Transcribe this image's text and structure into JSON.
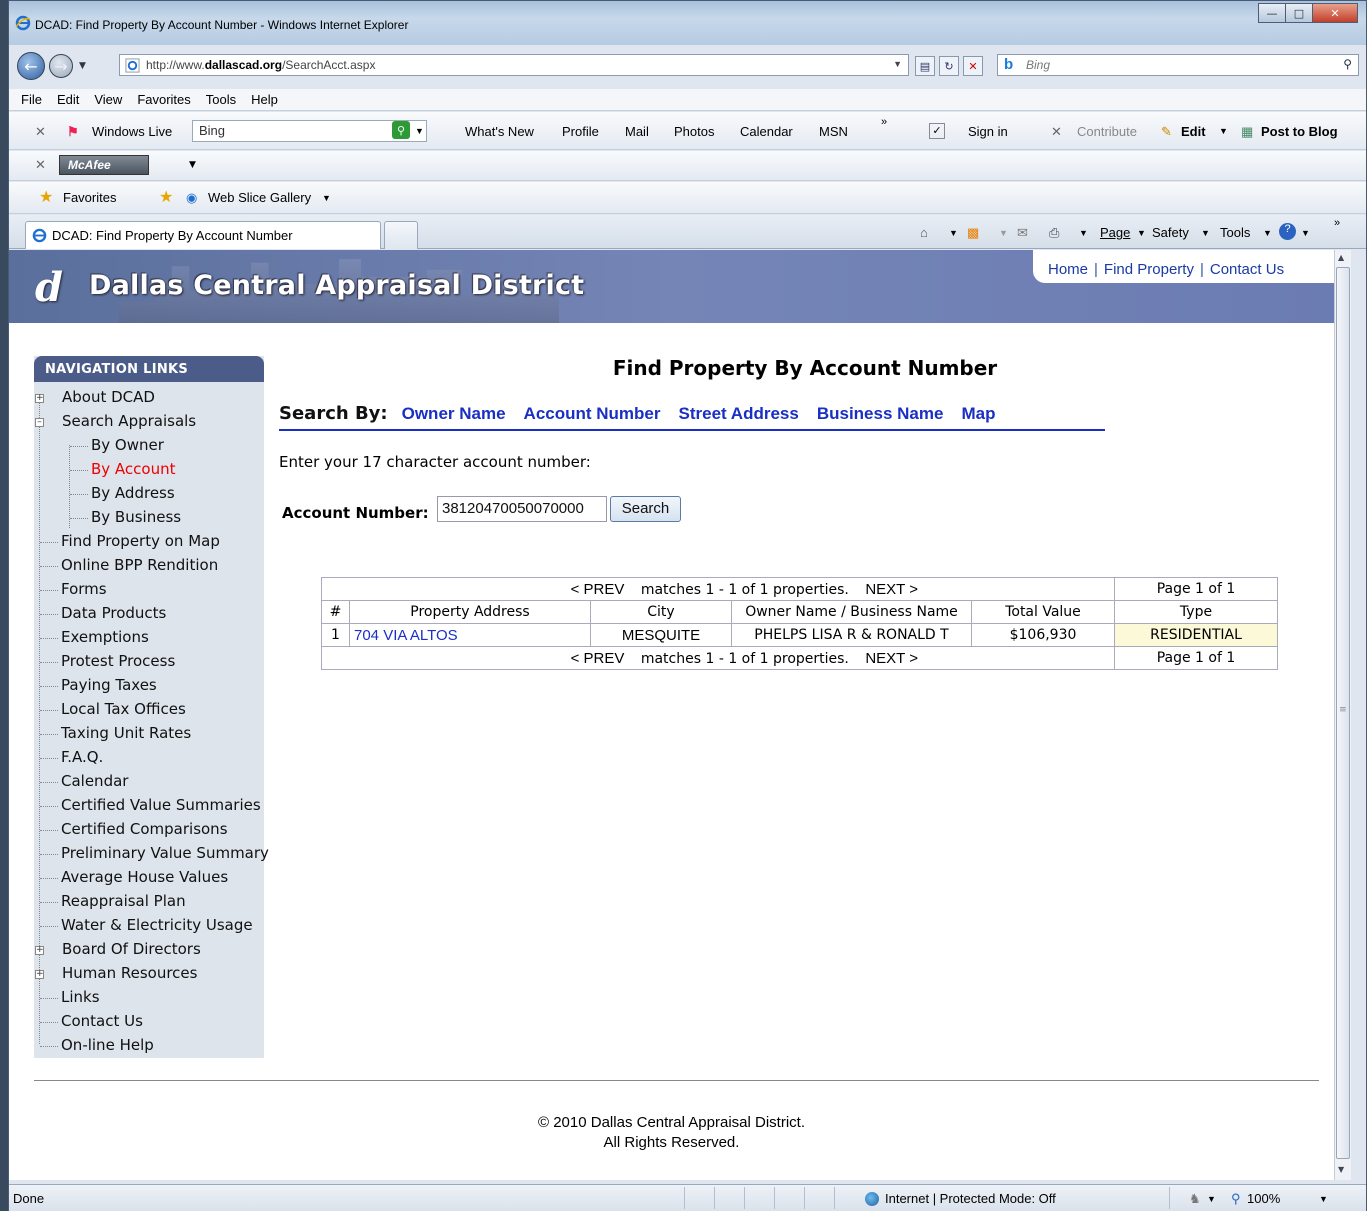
{
  "window": {
    "title": "DCAD: Find Property By Account Number - Windows Internet Explorer",
    "url_prefix": "http://www.",
    "url_domain": "dallascad.org",
    "url_path": "/SearchAcct.aspx",
    "search_engine": "Bing"
  },
  "menu": [
    "File",
    "Edit",
    "View",
    "Favorites",
    "Tools",
    "Help"
  ],
  "toolbar": {
    "windows_live": "Windows Live",
    "search_value": "Bing",
    "links": [
      "What's New",
      "Profile",
      "Mail",
      "Photos",
      "Calendar",
      "MSN"
    ],
    "sign_in": "Sign in",
    "contribute": "Contribute",
    "edit": "Edit",
    "post_to_blog": "Post to Blog",
    "mcafee": "McAfee"
  },
  "favorites_bar": {
    "favorites": "Favorites",
    "web_slice": "Web Slice Gallery"
  },
  "tab": {
    "title": "DCAD: Find Property By Account Number",
    "page_menu": "Page",
    "safety_menu": "Safety",
    "tools_menu": "Tools"
  },
  "site": {
    "name": "Dallas Central Appraisal District",
    "top_links": [
      "Home",
      "Find Property",
      "Contact Us"
    ]
  },
  "nav": {
    "header": "NAVIGATION LINKS",
    "items": [
      "About DCAD",
      "Search Appraisals",
      "By Owner",
      "By Account",
      "By Address",
      "By Business",
      "Find Property on Map",
      "Online BPP Rendition",
      "Forms",
      "Data Products",
      "Exemptions",
      "Protest Process",
      "Paying Taxes",
      "Local Tax Offices",
      "Taxing Unit Rates",
      "F.A.Q.",
      "Calendar",
      "Certified Value Summaries",
      "Certified Comparisons",
      "Preliminary Value Summary",
      "Average House Values",
      "Reappraisal Plan",
      "Water & Electricity Usage",
      "Board Of Directors",
      "Human Resources",
      "Links",
      "Contact Us",
      "On-line Help"
    ]
  },
  "main": {
    "title": "Find Property By Account Number",
    "search_by_label": "Search By:",
    "search_by_links": [
      "Owner Name",
      "Account Number",
      "Street Address",
      "Business Name",
      "Map"
    ],
    "instructions": "Enter your 17 character account number:",
    "account_label": "Account Number:",
    "account_value": "38120470050070000",
    "search_button": "Search"
  },
  "results": {
    "prev": "< PREV",
    "matches": "matches 1 - 1 of 1 properties.",
    "next": "NEXT >",
    "page": "Page 1 of 1",
    "headers": [
      "#",
      "Property Address",
      "City",
      "Owner Name / Business Name",
      "Total Value",
      "Type"
    ],
    "rows": [
      [
        "1",
        "704 VIA ALTOS",
        "MESQUITE",
        "PHELPS LISA R & RONALD T",
        "$106,930",
        "RESIDENTIAL"
      ]
    ]
  },
  "footer": {
    "line1": "© 2010 Dallas Central Appraisal District.",
    "line2": "All Rights Reserved."
  },
  "status": {
    "left": "Done",
    "zone": "Internet | Protected Mode: Off",
    "zoom": "100%"
  },
  "colors": {
    "banner": "#6b7cb3",
    "nav_header": "#4b5c88",
    "nav_bg": "#dde4ec",
    "link": "#1a2fc4",
    "active_nav": "#e00000",
    "type_cell": "#fbf9d7"
  }
}
